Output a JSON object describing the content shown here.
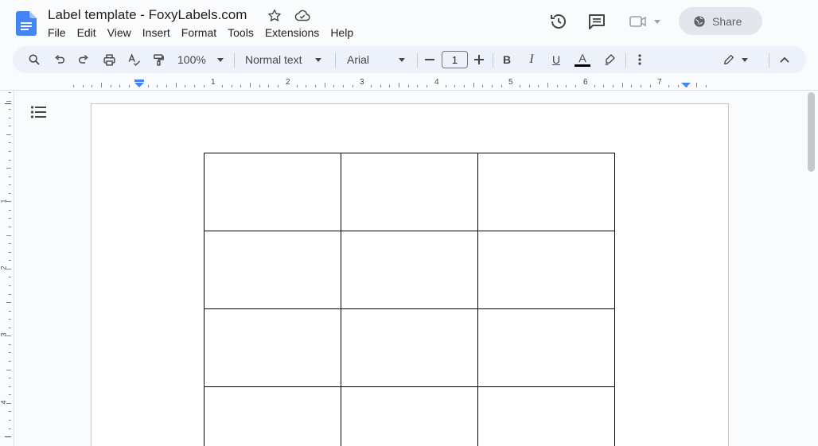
{
  "header": {
    "title": "Label template - FoxyLabels.com",
    "menu": [
      "File",
      "Edit",
      "View",
      "Insert",
      "Format",
      "Tools",
      "Extensions",
      "Help"
    ],
    "share_label": "Share"
  },
  "toolbar": {
    "zoom": "100%",
    "style": "Normal text",
    "font": "Arial",
    "font_size": "1",
    "bold": "B",
    "italic": "I",
    "underline": "U",
    "text_color_glyph": "A"
  },
  "ruler": {
    "numbers": [
      "1",
      "2",
      "3",
      "4",
      "5",
      "6",
      "7"
    ]
  },
  "vruler": {
    "numbers": [
      "1",
      "2",
      "3",
      "4"
    ]
  },
  "table": {
    "rows": 4,
    "cols": 3
  },
  "colors": {
    "brand": "#4285f4",
    "toolbar_bg": "#edf2fa",
    "share_bg": "#e3e7ed"
  }
}
